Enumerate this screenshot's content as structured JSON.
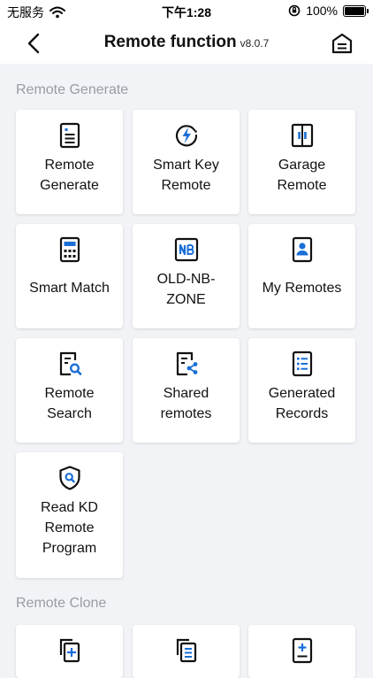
{
  "status_bar": {
    "carrier": "无服务",
    "time": "下午1:28",
    "battery": "100%"
  },
  "header": {
    "title": "Remote function",
    "version": "v8.0.7"
  },
  "sections": [
    {
      "title": "Remote Generate",
      "items": [
        {
          "label": "Remote\nGenerate",
          "icon": "remote-generate-icon"
        },
        {
          "label": "Smart Key\nRemote",
          "icon": "smart-key-icon"
        },
        {
          "label": "Garage\nRemote",
          "icon": "garage-icon"
        },
        {
          "label": "Smart Match",
          "icon": "calculator-icon"
        },
        {
          "label": "OLD-NB-\nZONE",
          "icon": "nb-icon"
        },
        {
          "label": "My Remotes",
          "icon": "user-card-icon"
        },
        {
          "label": "Remote\nSearch",
          "icon": "document-search-icon"
        },
        {
          "label": "Shared\nremotes",
          "icon": "document-share-icon"
        },
        {
          "label": "Generated\nRecords",
          "icon": "list-icon"
        },
        {
          "label": "Read KD\nRemote\nProgram",
          "icon": "shield-search-icon"
        }
      ]
    },
    {
      "title": "Remote Clone",
      "items": [
        {
          "label": "",
          "icon": "copy-add-icon"
        },
        {
          "label": "",
          "icon": "copy-list-icon"
        },
        {
          "label": "",
          "icon": "document-add-icon"
        }
      ]
    }
  ],
  "colors": {
    "accent": "#1a6ed8",
    "icon": "#111111",
    "background": "#f2f3f7",
    "section_title": "#9a9ca3"
  }
}
